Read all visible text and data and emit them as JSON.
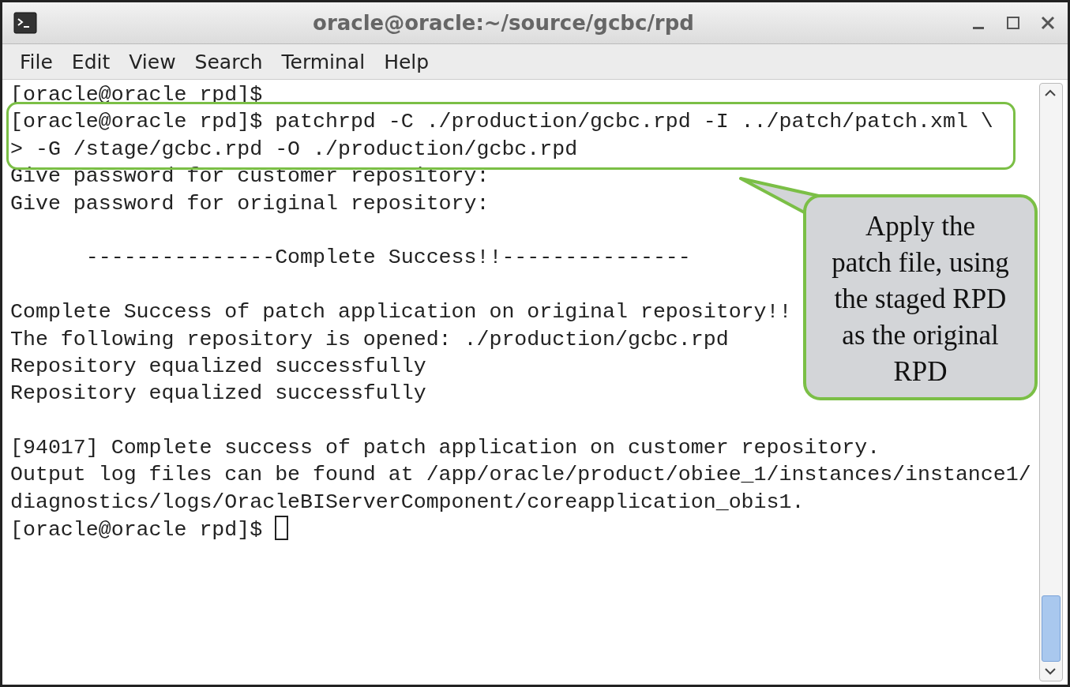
{
  "window": {
    "title": "oracle@oracle:~/source/gcbc/rpd"
  },
  "menu": [
    "File",
    "Edit",
    "View",
    "Search",
    "Terminal",
    "Help"
  ],
  "terminal": {
    "blocks": [
      [
        "[oracle@oracle rpd]$",
        "[oracle@oracle rpd]$ patchrpd -C ./production/gcbc.rpd -I ../patch/patch.xml \\",
        "> -G /stage/gcbc.rpd -O ./production/gcbc.rpd",
        "Give password for customer repository:",
        "Give password for original repository:"
      ],
      [
        "      ---------------Complete Success!!---------------"
      ],
      [
        "Complete Success of patch application on original repository!!",
        "The following repository is opened: ./production/gcbc.rpd",
        "Repository equalized successfully",
        "Repository equalized successfully"
      ],
      [
        "[94017] Complete success of patch application on customer repository.",
        "Output log files can be found at /app/oracle/product/obiee_1/instances/instance1/",
        "diagnostics/logs/OracleBIServerComponent/coreapplication_obis1.",
        "[oracle@oracle rpd]$ "
      ]
    ],
    "cursor": true
  },
  "callout": {
    "text": "Apply the\npatch file, using\nthe staged RPD\nas the original\nRPD"
  }
}
